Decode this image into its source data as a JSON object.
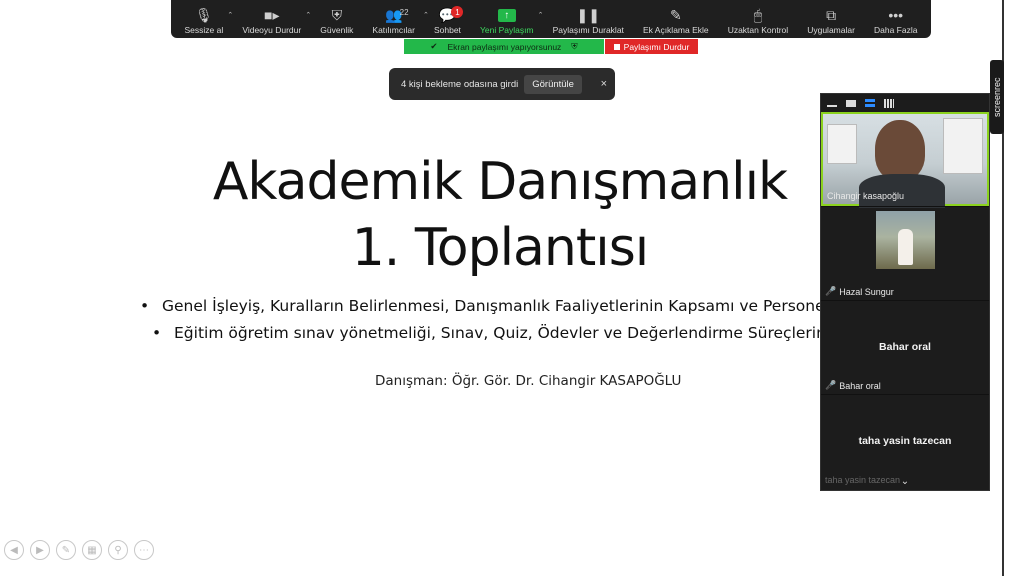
{
  "toolbar": {
    "items": [
      {
        "label": "Sessize al",
        "icon": "microphone-icon"
      },
      {
        "label": "Videoyu Durdur",
        "icon": "video-camera-icon"
      },
      {
        "label": "Güvenlik",
        "icon": "shield-icon"
      },
      {
        "label": "Katılımcılar",
        "icon": "participants-icon",
        "count": "22"
      },
      {
        "label": "Sohbet",
        "icon": "chat-icon",
        "badge": "1"
      },
      {
        "label": "Yeni Paylaşım",
        "icon": "share-screen-icon"
      },
      {
        "label": "Paylaşımı Duraklat",
        "icon": "pause-icon"
      },
      {
        "label": "Ek Açıklama Ekle",
        "icon": "pen-icon"
      },
      {
        "label": "Uzaktan Kontrol",
        "icon": "mouse-icon"
      },
      {
        "label": "Uygulamalar",
        "icon": "apps-icon"
      },
      {
        "label": "Daha Fazla",
        "icon": "more-icon"
      }
    ],
    "accent_green": "#23b84a",
    "accent_red": "#e02828"
  },
  "share_status": {
    "text": "Ekran paylaşımı yapıyorsunuz",
    "stop_label": "Paylaşımı Durdur"
  },
  "notification": {
    "text": "4 kişi bekleme odasına girdi",
    "button_label": "Görüntüle",
    "close": "×"
  },
  "slide": {
    "title_line1": "Akademik Danışmanlık",
    "title_line2": "1. Toplantısı",
    "bullets": [
      "Genel İşleyiş, Kuralların Belirlenmesi, Danışmanlık Faaliyetlerinin Kapsamı ve Personel",
      "Eğitim öğretim sınav yönetmeliği, Sınav, Quiz, Ödevler ve Değerlendirme Süreçlerinin"
    ],
    "advisor": "Danışman: Öğr. Gör. Dr. Cihangir KASAPOĞLU"
  },
  "participants": [
    {
      "name": "Cihangir kasapoğlu",
      "speaking": true
    },
    {
      "name": "Hazal Sungur",
      "muted": true
    },
    {
      "name": "Bahar oral",
      "muted": true,
      "display": "Bahar oral"
    },
    {
      "name": "taha yasin tazecan",
      "display": "taha yasin tazecan"
    }
  ],
  "screenrec": {
    "label": "screenrec"
  }
}
